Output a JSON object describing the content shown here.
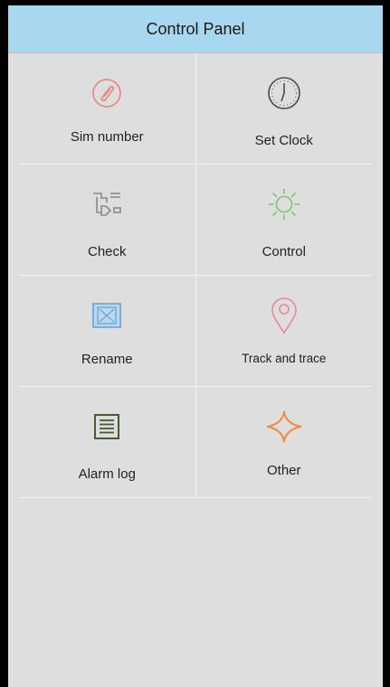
{
  "header": {
    "title": "Control Panel"
  },
  "menu": [
    {
      "label": "Sim number",
      "icon": "phone-icon",
      "color": "#e8857a"
    },
    {
      "label": "Set Clock",
      "icon": "clock-icon",
      "color": "#4a4a4a"
    },
    {
      "label": "Check",
      "icon": "check-icon",
      "color": "#8a8a8a"
    },
    {
      "label": "Control",
      "icon": "sun-gear-icon",
      "color": "#7cc87c"
    },
    {
      "label": "Rename",
      "icon": "rename-box-icon",
      "color": "#6fa8d8"
    },
    {
      "label": "Track and trace",
      "icon": "location-pin-icon",
      "color": "#e8879a"
    },
    {
      "label": "Alarm log",
      "icon": "log-list-icon",
      "color": "#4a5a30"
    },
    {
      "label": "Other",
      "icon": "star-outline-icon",
      "color": "#f08a3a"
    }
  ]
}
